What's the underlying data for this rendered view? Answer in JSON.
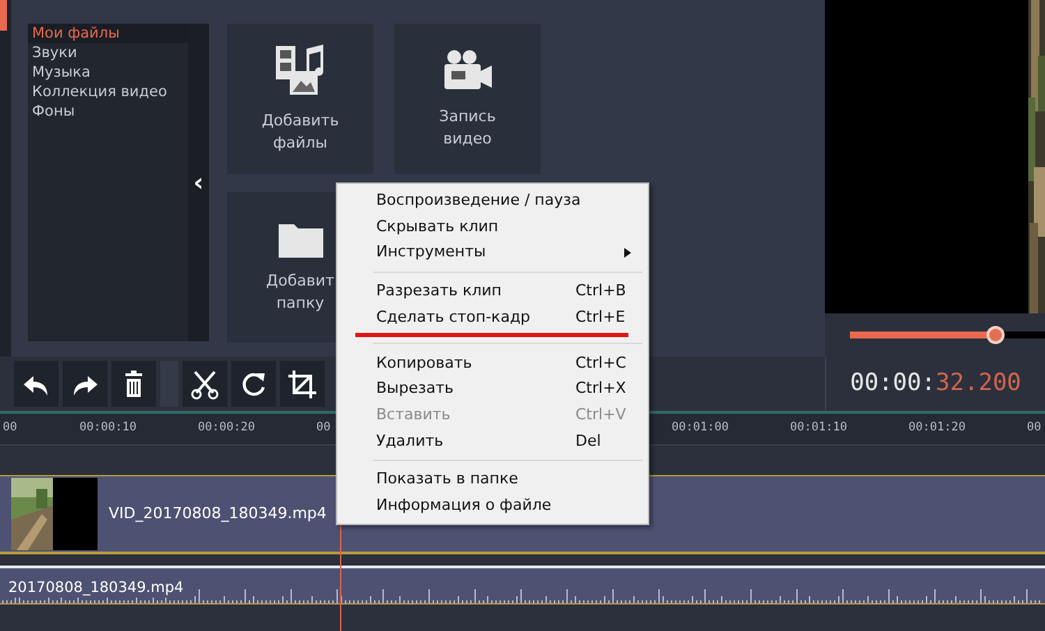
{
  "library": {
    "items": [
      {
        "label": "Мои файлы",
        "selected": true
      },
      {
        "label": "Звуки",
        "selected": false
      },
      {
        "label": "Музыка",
        "selected": false
      },
      {
        "label": "Коллекция видео",
        "selected": false
      },
      {
        "label": "Фоны",
        "selected": false
      }
    ]
  },
  "collapse_button": "‹",
  "tiles": [
    {
      "kind": "files",
      "label": "Добавить\nфайлы"
    },
    {
      "kind": "camera",
      "label": "Запись\nвидео"
    },
    {
      "kind": "folder",
      "label": "Добавит\nпапку"
    }
  ],
  "preview": {
    "kind": "picture",
    "seek": {
      "level": 0.74
    }
  },
  "toolbar": [
    {
      "kind": "undo"
    },
    {
      "kind": "redo"
    },
    {
      "kind": "delete"
    },
    {
      "kind": "gap"
    },
    {
      "kind": "cut"
    },
    {
      "kind": "rotate"
    },
    {
      "kind": "crop"
    }
  ],
  "timecode": {
    "base": "00:00:",
    "current": "32.200"
  },
  "ruler": [
    "00",
    "00:00:10",
    "00:00:20",
    "00",
    "00:01:00",
    "00:01:10",
    "00:01:20",
    "00"
  ],
  "tracks": [
    {
      "kind": "video",
      "name": "VID_20170808_180349.mp4"
    },
    {
      "kind": "audio",
      "name": "20170808_180349.mp4"
    }
  ],
  "context_menu": [
    {
      "kind": "item",
      "label": "Воспроизведение / пауза",
      "disabled": false
    },
    {
      "kind": "item",
      "label": "Скрывать клип",
      "disabled": false
    },
    {
      "kind": "item",
      "label": "Инструменты",
      "disabled": false,
      "submenu": true
    },
    {
      "kind": "separator"
    },
    {
      "kind": "item",
      "label": "Разрезать клип",
      "shortcut": "Ctrl+B",
      "disabled": false
    },
    {
      "kind": "item",
      "label": "Сделать стоп-кадр",
      "shortcut": "Ctrl+E",
      "disabled": false,
      "underlined": true
    },
    {
      "kind": "separator"
    },
    {
      "kind": "item",
      "label": "Копировать",
      "shortcut": "Ctrl+C",
      "disabled": false
    },
    {
      "kind": "item",
      "label": "Вырезать",
      "shortcut": "Ctrl+X",
      "disabled": false
    },
    {
      "kind": "item",
      "label": "Вставить",
      "shortcut": "Ctrl+V",
      "disabled": true
    },
    {
      "kind": "item",
      "label": "Удалить",
      "shortcut": "Del",
      "disabled": false
    },
    {
      "kind": "separator"
    },
    {
      "kind": "item",
      "label": "Показать в папке",
      "disabled": false
    },
    {
      "kind": "item",
      "label": "Информация о файле",
      "disabled": false
    }
  ]
}
